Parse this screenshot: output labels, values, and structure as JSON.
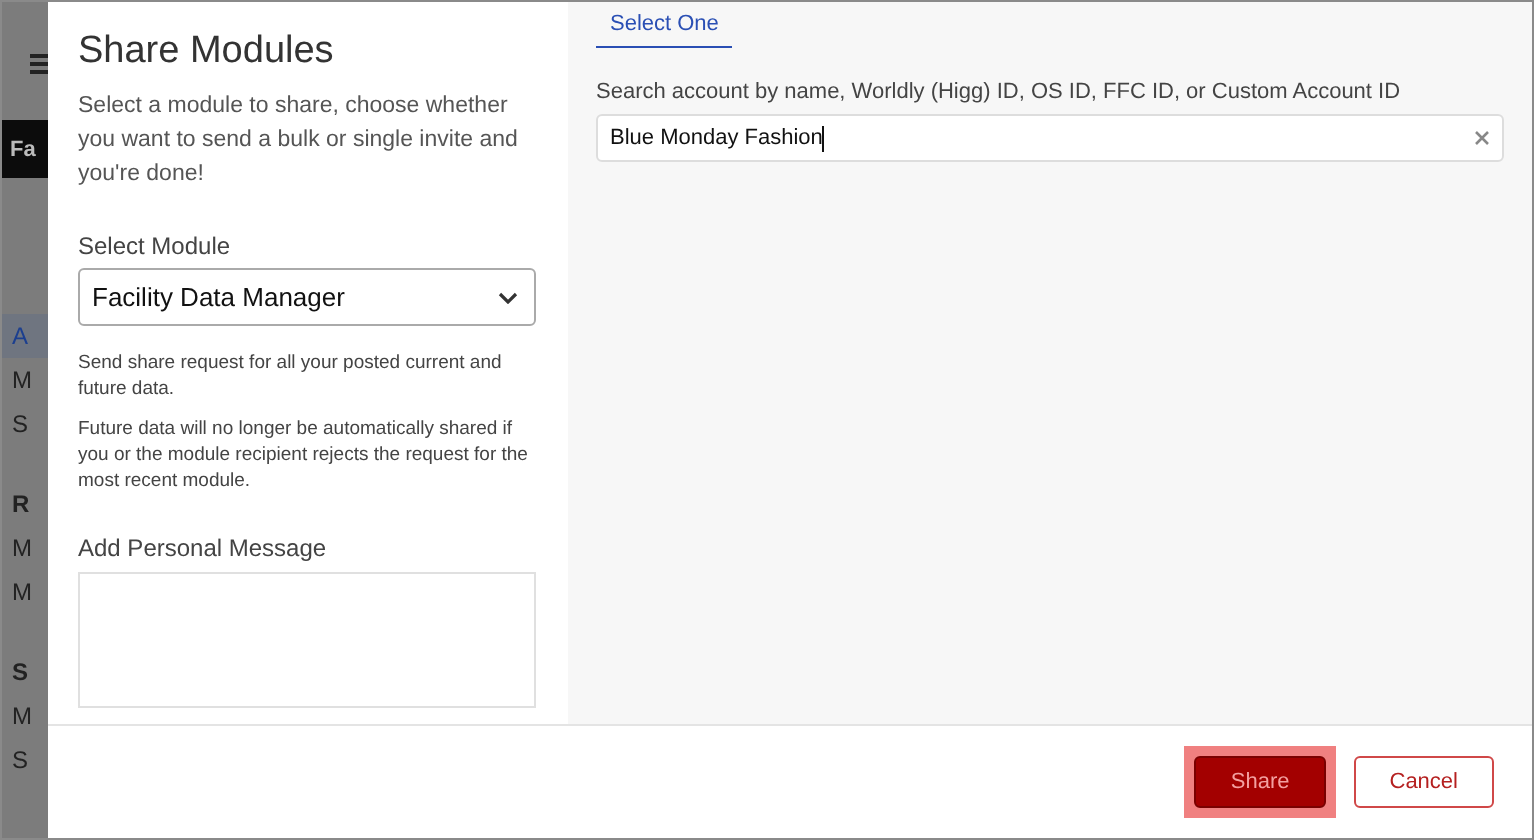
{
  "background_page": {
    "header_letters": "Fa",
    "sidebar_items": [
      {
        "text": "A",
        "selected": true,
        "kind": "item"
      },
      {
        "text": "M",
        "selected": false,
        "kind": "item"
      },
      {
        "text": "S",
        "selected": false,
        "kind": "item"
      },
      {
        "text": "R",
        "selected": false,
        "kind": "heading"
      },
      {
        "text": "M",
        "selected": false,
        "kind": "item"
      },
      {
        "text": "M",
        "selected": false,
        "kind": "item"
      },
      {
        "text": "S",
        "selected": false,
        "kind": "heading"
      },
      {
        "text": "M",
        "selected": false,
        "kind": "item"
      },
      {
        "text": "S",
        "selected": false,
        "kind": "item"
      }
    ]
  },
  "dialog": {
    "title": "Share Modules",
    "description": "Select a module to share, choose whether you want to send a bulk or single invite and you're done!",
    "module_label": "Select Module",
    "module_value": "Facility Data Manager",
    "notes": [
      "Send share request for all your posted current and future data.",
      "Future data will no longer be automatically shared if you or the module recipient rejects the request for the most recent module."
    ],
    "message_label": "Add Personal Message",
    "tabs": [
      {
        "label": "Select One",
        "selected": true
      }
    ],
    "search_label": "Search account by name, Worldly (Higg) ID, OS ID, FFC ID, or Custom Account ID",
    "search_value": "Blue Monday Fashion",
    "buttons": [
      {
        "label": "Share",
        "kind": "primary",
        "focused": true
      },
      {
        "label": "Cancel",
        "kind": "secondary",
        "focused": false
      }
    ]
  }
}
